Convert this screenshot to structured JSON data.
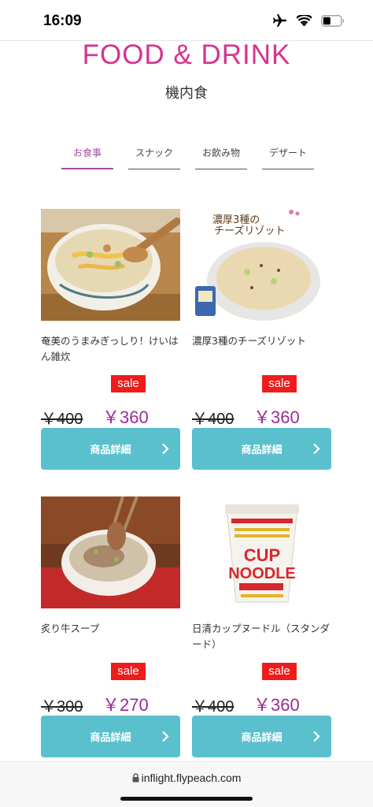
{
  "status_bar": {
    "time": "16:09",
    "icons": [
      "airplane-icon",
      "wifi-icon",
      "battery-icon"
    ]
  },
  "page": {
    "title": "FOOD & DRINK",
    "subtitle": "機内食"
  },
  "tabs": [
    {
      "label": "お食事",
      "active": true
    },
    {
      "label": "スナック",
      "active": false
    },
    {
      "label": "お飲み物",
      "active": false
    },
    {
      "label": "デザート",
      "active": false
    }
  ],
  "products": [
    {
      "name": "奄美のうまみぎっしり！けいはん雑炊",
      "badge": "sale",
      "old_price": "￥400",
      "new_price": "￥360",
      "button": "商品詳細"
    },
    {
      "name": "濃厚3種のチーズリゾット",
      "badge": "sale",
      "old_price": "￥400",
      "new_price": "￥360",
      "button": "商品詳細",
      "image_text": [
        "濃厚3種の",
        "チーズリゾット"
      ]
    },
    {
      "name": "炙り牛スープ",
      "badge": "sale",
      "old_price": "￥300",
      "new_price": "￥270",
      "button": "商品詳細"
    },
    {
      "name": "日清カップヌードル（スタンダード）",
      "badge": "sale",
      "old_price": "￥400",
      "new_price": "￥360",
      "button": "商品詳細"
    }
  ],
  "colors": {
    "title": "#d6338f",
    "active_tab": "#a64ca6",
    "sale_badge": "#ef1c1c",
    "sale_price": "#9b2c93",
    "button": "#5bc0cd"
  },
  "url_bar": {
    "url": "inflight.flypeach.com"
  }
}
